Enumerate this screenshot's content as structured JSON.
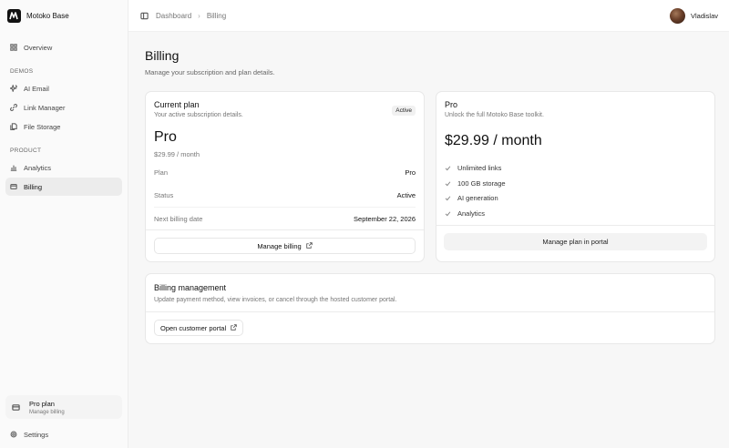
{
  "sidebar": {
    "brand": "Motoko Base",
    "overview": "Overview",
    "demos_label": "DEMOS",
    "demos": [
      "AI Email",
      "Link Manager",
      "File Storage"
    ],
    "product_label": "PRODUCT",
    "product": [
      "Analytics",
      "Billing"
    ],
    "plan_title": "Pro plan",
    "plan_sub": "Manage billing",
    "settings": "Settings"
  },
  "topbar": {
    "crumbs": [
      "Dashboard",
      "Billing"
    ],
    "user": "Vladislav"
  },
  "page": {
    "title": "Billing",
    "subtitle": "Manage your subscription and plan details."
  },
  "current": {
    "title": "Current plan",
    "desc": "Your active subscription details.",
    "badge": "Active",
    "plan": "Pro",
    "price": "$29.99 / month",
    "rows": [
      {
        "k": "Plan",
        "v": "Pro"
      },
      {
        "k": "Status",
        "v": "Active"
      },
      {
        "k": "Next billing date",
        "v": "September 22, 2026"
      }
    ],
    "button": "Manage billing"
  },
  "pro": {
    "title": "Pro",
    "desc": "Unlock the full Motoko Base toolkit.",
    "price": "$29.99 / month",
    "features": [
      "Unlimited links",
      "100 GB storage",
      "AI generation",
      "Analytics"
    ],
    "button": "Manage plan in portal"
  },
  "billing_mgmt": {
    "title": "Billing management",
    "desc": "Update payment method, view invoices, or cancel through the hosted customer portal.",
    "button": "Open customer portal"
  }
}
